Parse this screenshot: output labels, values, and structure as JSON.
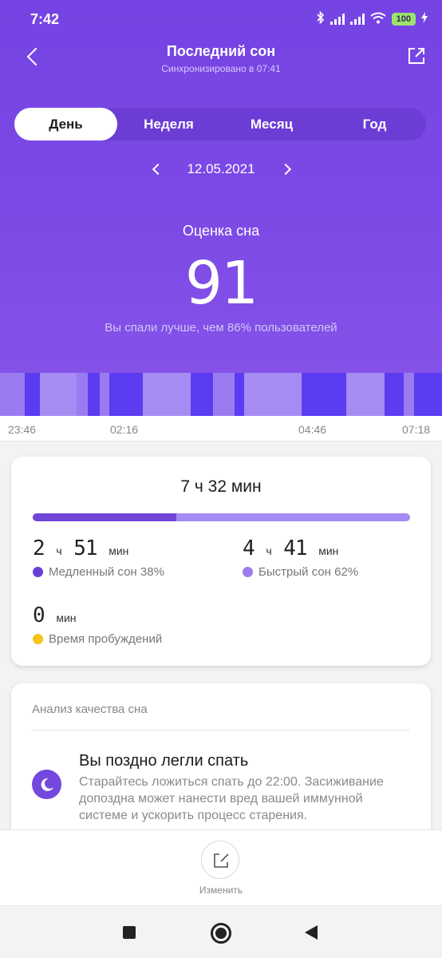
{
  "status": {
    "time": "7:42",
    "battery": "100"
  },
  "header": {
    "title": "Последний сон",
    "subtitle": "Синхронизировано в 07:41"
  },
  "tabs": [
    {
      "label": "День",
      "active": true
    },
    {
      "label": "Неделя",
      "active": false
    },
    {
      "label": "Месяц",
      "active": false
    },
    {
      "label": "Год",
      "active": false
    }
  ],
  "date": "12.05.2021",
  "score": {
    "label": "Оценка сна",
    "value": "91",
    "note": "Вы спали лучше, чем 86% пользователей"
  },
  "timeline": {
    "ticks": [
      "23:46",
      "02:16",
      "04:46",
      "07:18"
    ]
  },
  "summary": {
    "total": "7 ч 32 мин",
    "deep_fraction": 0.38,
    "deep": {
      "h": "2",
      "h_unit": "ч",
      "m": "51",
      "m_unit": "мин",
      "label": "Медленный сон 38%",
      "color": "#6a3fd8"
    },
    "light": {
      "h": "4",
      "h_unit": "ч",
      "m": "41",
      "m_unit": "мин",
      "label": "Быстрый сон 62%",
      "color": "#9b7cf0"
    },
    "awake": {
      "m": "0",
      "m_unit": "мин",
      "label": "Время пробуждений",
      "color": "#f5c518"
    }
  },
  "analysis": {
    "heading": "Анализ качества сна",
    "tip_title": "Вы поздно легли спать",
    "tip_text": "Старайтесь ложиться спать до 22:00. Засиживание допоздна может нанести вред вашей иммунной системе и ускорить процесс старения."
  },
  "edit": {
    "label": "Изменить"
  },
  "colors": {
    "accent": "#7543e3",
    "deep": "#5b3cf0",
    "light": "#9a7cf0"
  }
}
